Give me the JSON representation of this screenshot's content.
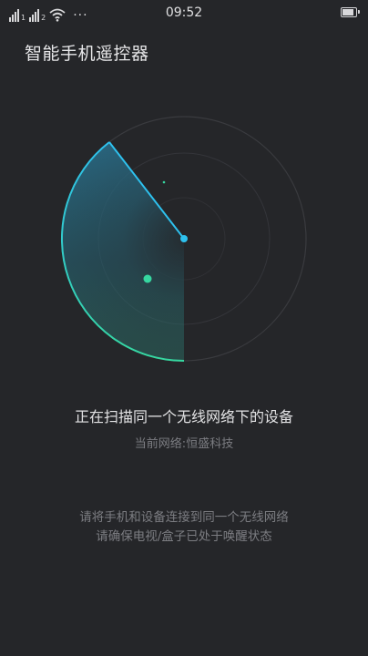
{
  "status_bar": {
    "time": "09:52",
    "sim1_label": "1",
    "sim2_label": "2",
    "more": "···",
    "battery_level": 0.9
  },
  "app": {
    "title": "智能手机遥控器"
  },
  "scan": {
    "status": "正在扫描同一个无线网络下的设备",
    "network_label": "当前网络:",
    "network_name": "恒盛科技"
  },
  "tips": {
    "line1": "请将手机和设备连接到同一个无线网络",
    "line2": "请确保电视/盒子已处于唤醒状态"
  },
  "colors": {
    "background": "#252629",
    "accent_cyan": "#2ec1ee",
    "accent_green": "#36d7a0"
  }
}
